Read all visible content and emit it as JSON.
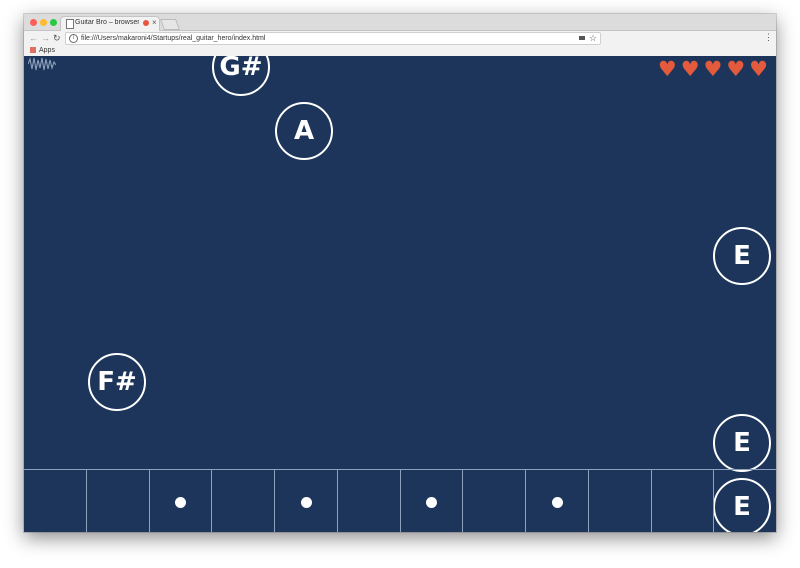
{
  "browser": {
    "tab_title": "Guitar Bro – browser game",
    "tab_close": "×",
    "url": "file:///Users/makaroni4/Startups/real_guitar_hero/index.html",
    "bookmarks": {
      "apps_label": "Apps"
    },
    "icons": [
      "back-arrow-icon",
      "forward-arrow-icon",
      "reload-icon",
      "info-icon",
      "camera-icon",
      "star-icon",
      "menu-icon",
      "apps-grid-icon"
    ]
  },
  "game": {
    "background_color": "#1d355a",
    "heart_color": "#e35a3d",
    "lives": 5,
    "notes": [
      {
        "name": "G#",
        "fret": 4
      },
      {
        "name": "A",
        "fret": 5
      },
      {
        "name": "E",
        "fret": 12
      },
      {
        "name": "F#",
        "fret": 2
      },
      {
        "name": "E",
        "fret": 12
      },
      {
        "name": "E",
        "fret": 12
      }
    ],
    "fretboard": {
      "fret_count": 12,
      "inlay_frets": [
        3,
        5,
        7,
        9
      ]
    }
  }
}
